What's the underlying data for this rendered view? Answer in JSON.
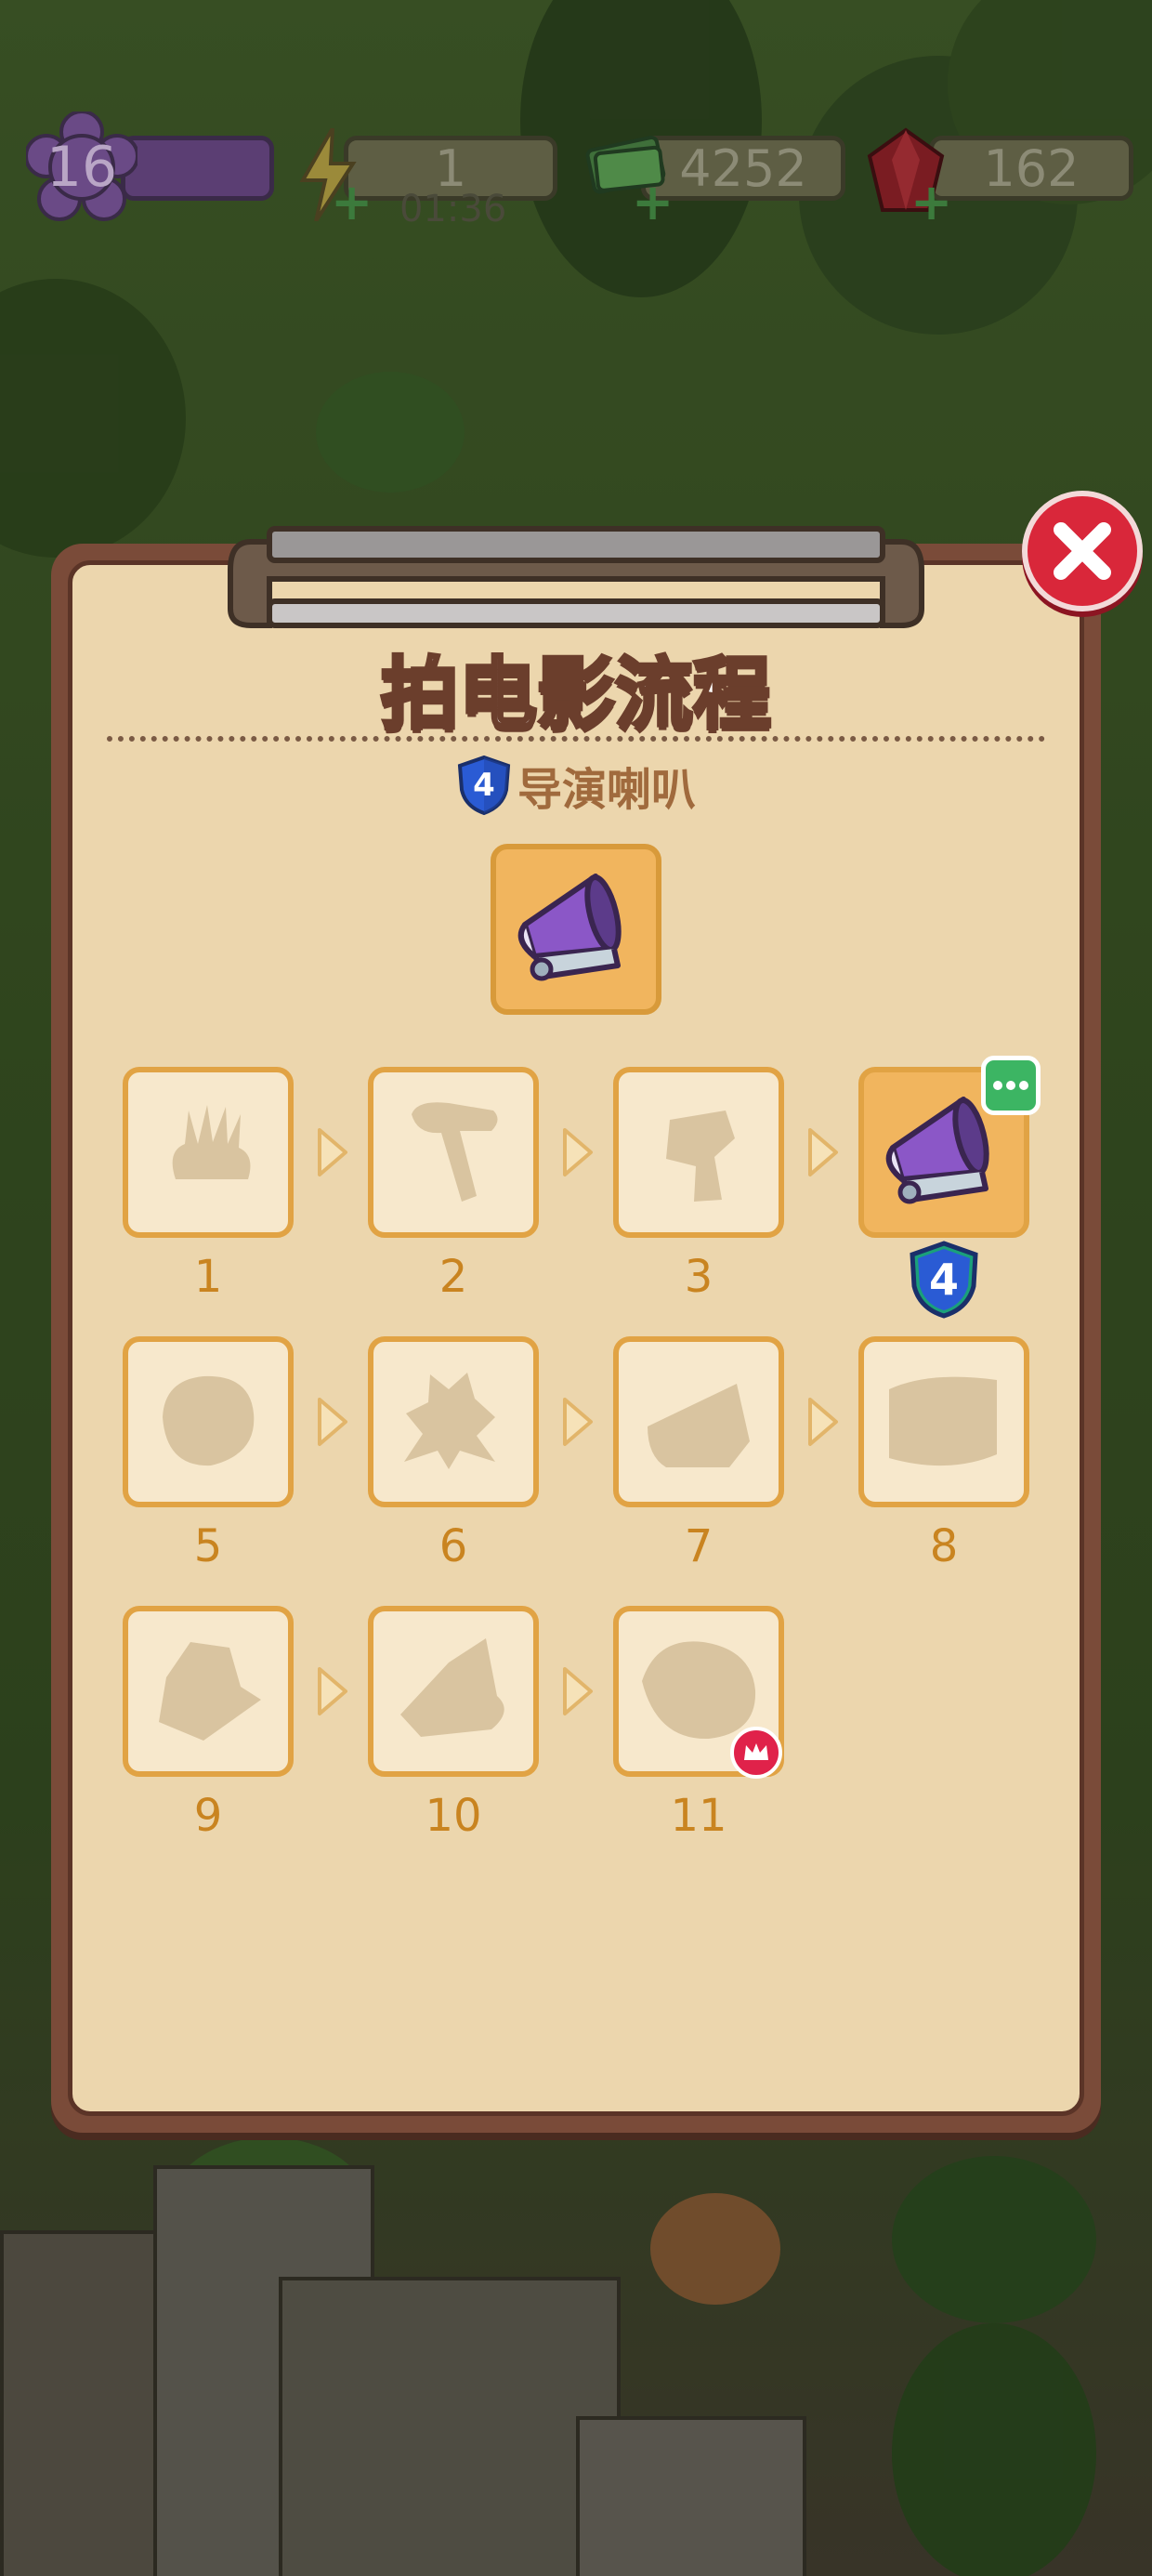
{
  "hud": {
    "level": "16",
    "energy": "1",
    "energy_timer": "01:36",
    "cash": "4252",
    "gems": "162"
  },
  "panel": {
    "title": "拍电影流程",
    "item_name": "导演喇叭",
    "item_level": "4"
  },
  "chain": [
    {
      "label": "1",
      "state": "locked",
      "icon": "clapper-silhouette-icon"
    },
    {
      "label": "2",
      "state": "locked",
      "icon": "hammer-silhouette-icon"
    },
    {
      "label": "3",
      "state": "locked",
      "icon": "camera-silhouette-icon"
    },
    {
      "label": "",
      "state": "current",
      "icon": "megaphone-icon",
      "level": "4"
    },
    {
      "label": "5",
      "state": "locked",
      "icon": "reel-silhouette-icon"
    },
    {
      "label": "6",
      "state": "locked",
      "icon": "film-silhouette-icon"
    },
    {
      "label": "7",
      "state": "locked",
      "icon": "chair-silhouette-icon"
    },
    {
      "label": "8",
      "state": "locked",
      "icon": "screen-silhouette-icon"
    },
    {
      "label": "9",
      "state": "locked",
      "icon": "hat-silhouette-icon"
    },
    {
      "label": "10",
      "state": "locked",
      "icon": "slate-silhouette-icon"
    },
    {
      "label": "11",
      "state": "locked-premium",
      "icon": "trophy-silhouette-icon"
    }
  ],
  "colors": {
    "panel_bg": "#ecd6ad",
    "slot_border": "#e1a344",
    "label": "#c98420",
    "close": "#d9273a"
  }
}
